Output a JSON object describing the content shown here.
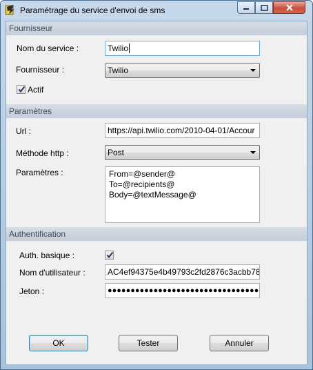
{
  "window": {
    "title": "Paramétrage du service d'envoi de sms"
  },
  "sections": {
    "fournisseur": "Fournisseur",
    "parametres": "Paramètres",
    "authentification": "Authentification"
  },
  "fournisseur": {
    "service_name_label": "Nom du service :",
    "service_name_value": "Twilio",
    "provider_label": "Fournisseur :",
    "provider_value": "Twilio",
    "active_label": "Actif",
    "active_checked": true
  },
  "parametres": {
    "url_label": "Url :",
    "url_value": "https://api.twilio.com/2010-04-01/Accour",
    "method_label": "Méthode http :",
    "method_value": "Post",
    "params_label": "Paramètres :",
    "params_lines": [
      "From=@sender@",
      "To=@recipients@",
      "Body=@textMessage@"
    ]
  },
  "authentification": {
    "basic_label": "Auth. basique :",
    "basic_checked": true,
    "username_label": "Nom d'utilisateur :",
    "username_value": "AC4ef94375e4b49793c2fd2876c3acbb78",
    "token_label": "Jeton :",
    "token_value": "●●●●●●●●●●●●●●●●●●●●●●●●●●●●●●●●●●●●●●"
  },
  "buttons": {
    "ok": "OK",
    "test": "Tester",
    "cancel": "Annuler"
  }
}
